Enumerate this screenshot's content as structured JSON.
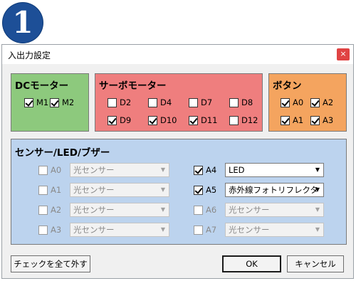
{
  "badge": "1",
  "window": {
    "title": "入出力設定",
    "close_glyph": "×"
  },
  "dc_motor": {
    "title": "DCモーター",
    "items": [
      {
        "label": "M1",
        "checked": true
      },
      {
        "label": "M2",
        "checked": true
      }
    ]
  },
  "servo_motor": {
    "title": "サーボモーター",
    "items": [
      {
        "label": "D2",
        "checked": false
      },
      {
        "label": "D4",
        "checked": false
      },
      {
        "label": "D7",
        "checked": false
      },
      {
        "label": "D8",
        "checked": false
      },
      {
        "label": "D9",
        "checked": true
      },
      {
        "label": "D10",
        "checked": true
      },
      {
        "label": "D11",
        "checked": true
      },
      {
        "label": "D12",
        "checked": false
      }
    ]
  },
  "buttons_panel": {
    "title": "ボタン",
    "items": [
      {
        "label": "A0",
        "checked": true
      },
      {
        "label": "A2",
        "checked": true
      },
      {
        "label": "A1",
        "checked": true
      },
      {
        "label": "A3",
        "checked": true
      }
    ]
  },
  "sensor_panel": {
    "title": "センサー/LED/ブザー",
    "rows": [
      {
        "label": "A0",
        "checked": false,
        "enabled": false,
        "value": "光センサー"
      },
      {
        "label": "A1",
        "checked": false,
        "enabled": false,
        "value": "光センサー"
      },
      {
        "label": "A2",
        "checked": false,
        "enabled": false,
        "value": "光センサー"
      },
      {
        "label": "A3",
        "checked": false,
        "enabled": false,
        "value": "光センサー"
      },
      {
        "label": "A4",
        "checked": true,
        "enabled": true,
        "value": "LED"
      },
      {
        "label": "A5",
        "checked": true,
        "enabled": true,
        "value": "赤外線フォトリフレクタ"
      },
      {
        "label": "A6",
        "checked": false,
        "enabled": false,
        "value": "光センサー"
      },
      {
        "label": "A7",
        "checked": false,
        "enabled": false,
        "value": "光センサー"
      }
    ]
  },
  "footer": {
    "uncheck_all": "チェックを全て外す",
    "ok": "OK",
    "cancel": "キャンセル"
  },
  "colors": {
    "dc_bg": "#8dc97d",
    "servo_bg": "#ef7e7e",
    "button_bg": "#f4a45f",
    "sensor_bg": "#bcd3ee",
    "badge": "#1d4f97"
  }
}
